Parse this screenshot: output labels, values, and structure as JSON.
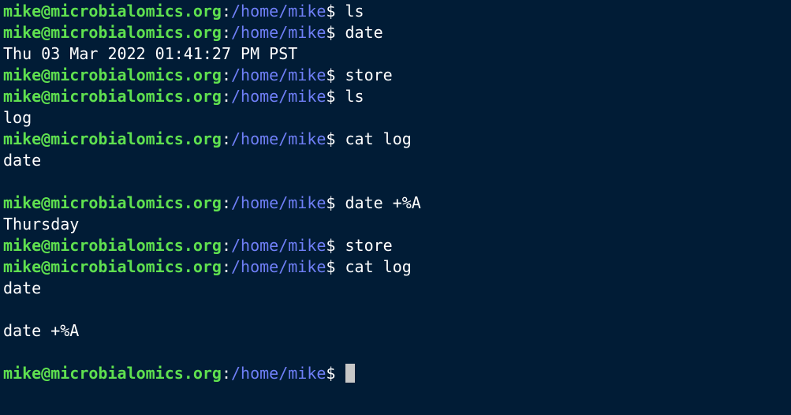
{
  "prompt": {
    "user_host": "mike@microbialomics.org",
    "colon": ":",
    "path": "/home/mike",
    "symbol": "$"
  },
  "colors": {
    "background": "#011c36",
    "user_host": "#5fe04f",
    "path": "#6f7ff7",
    "text": "#ffffff",
    "cursor": "#c7c7c7"
  },
  "lines": [
    {
      "type": "prompt",
      "command": " ls"
    },
    {
      "type": "prompt",
      "command": " date"
    },
    {
      "type": "output",
      "text": "Thu 03 Mar 2022 01:41:27 PM PST"
    },
    {
      "type": "prompt",
      "command": " store"
    },
    {
      "type": "prompt",
      "command": " ls"
    },
    {
      "type": "output",
      "text": "log"
    },
    {
      "type": "prompt",
      "command": " cat log"
    },
    {
      "type": "output",
      "text": "date"
    },
    {
      "type": "output",
      "text": ""
    },
    {
      "type": "prompt",
      "command": " date +%A"
    },
    {
      "type": "output",
      "text": "Thursday"
    },
    {
      "type": "prompt",
      "command": " store"
    },
    {
      "type": "prompt",
      "command": " cat log"
    },
    {
      "type": "output",
      "text": "date"
    },
    {
      "type": "output",
      "text": ""
    },
    {
      "type": "output",
      "text": "date +%A"
    },
    {
      "type": "output",
      "text": ""
    },
    {
      "type": "active-prompt",
      "command": " "
    }
  ]
}
